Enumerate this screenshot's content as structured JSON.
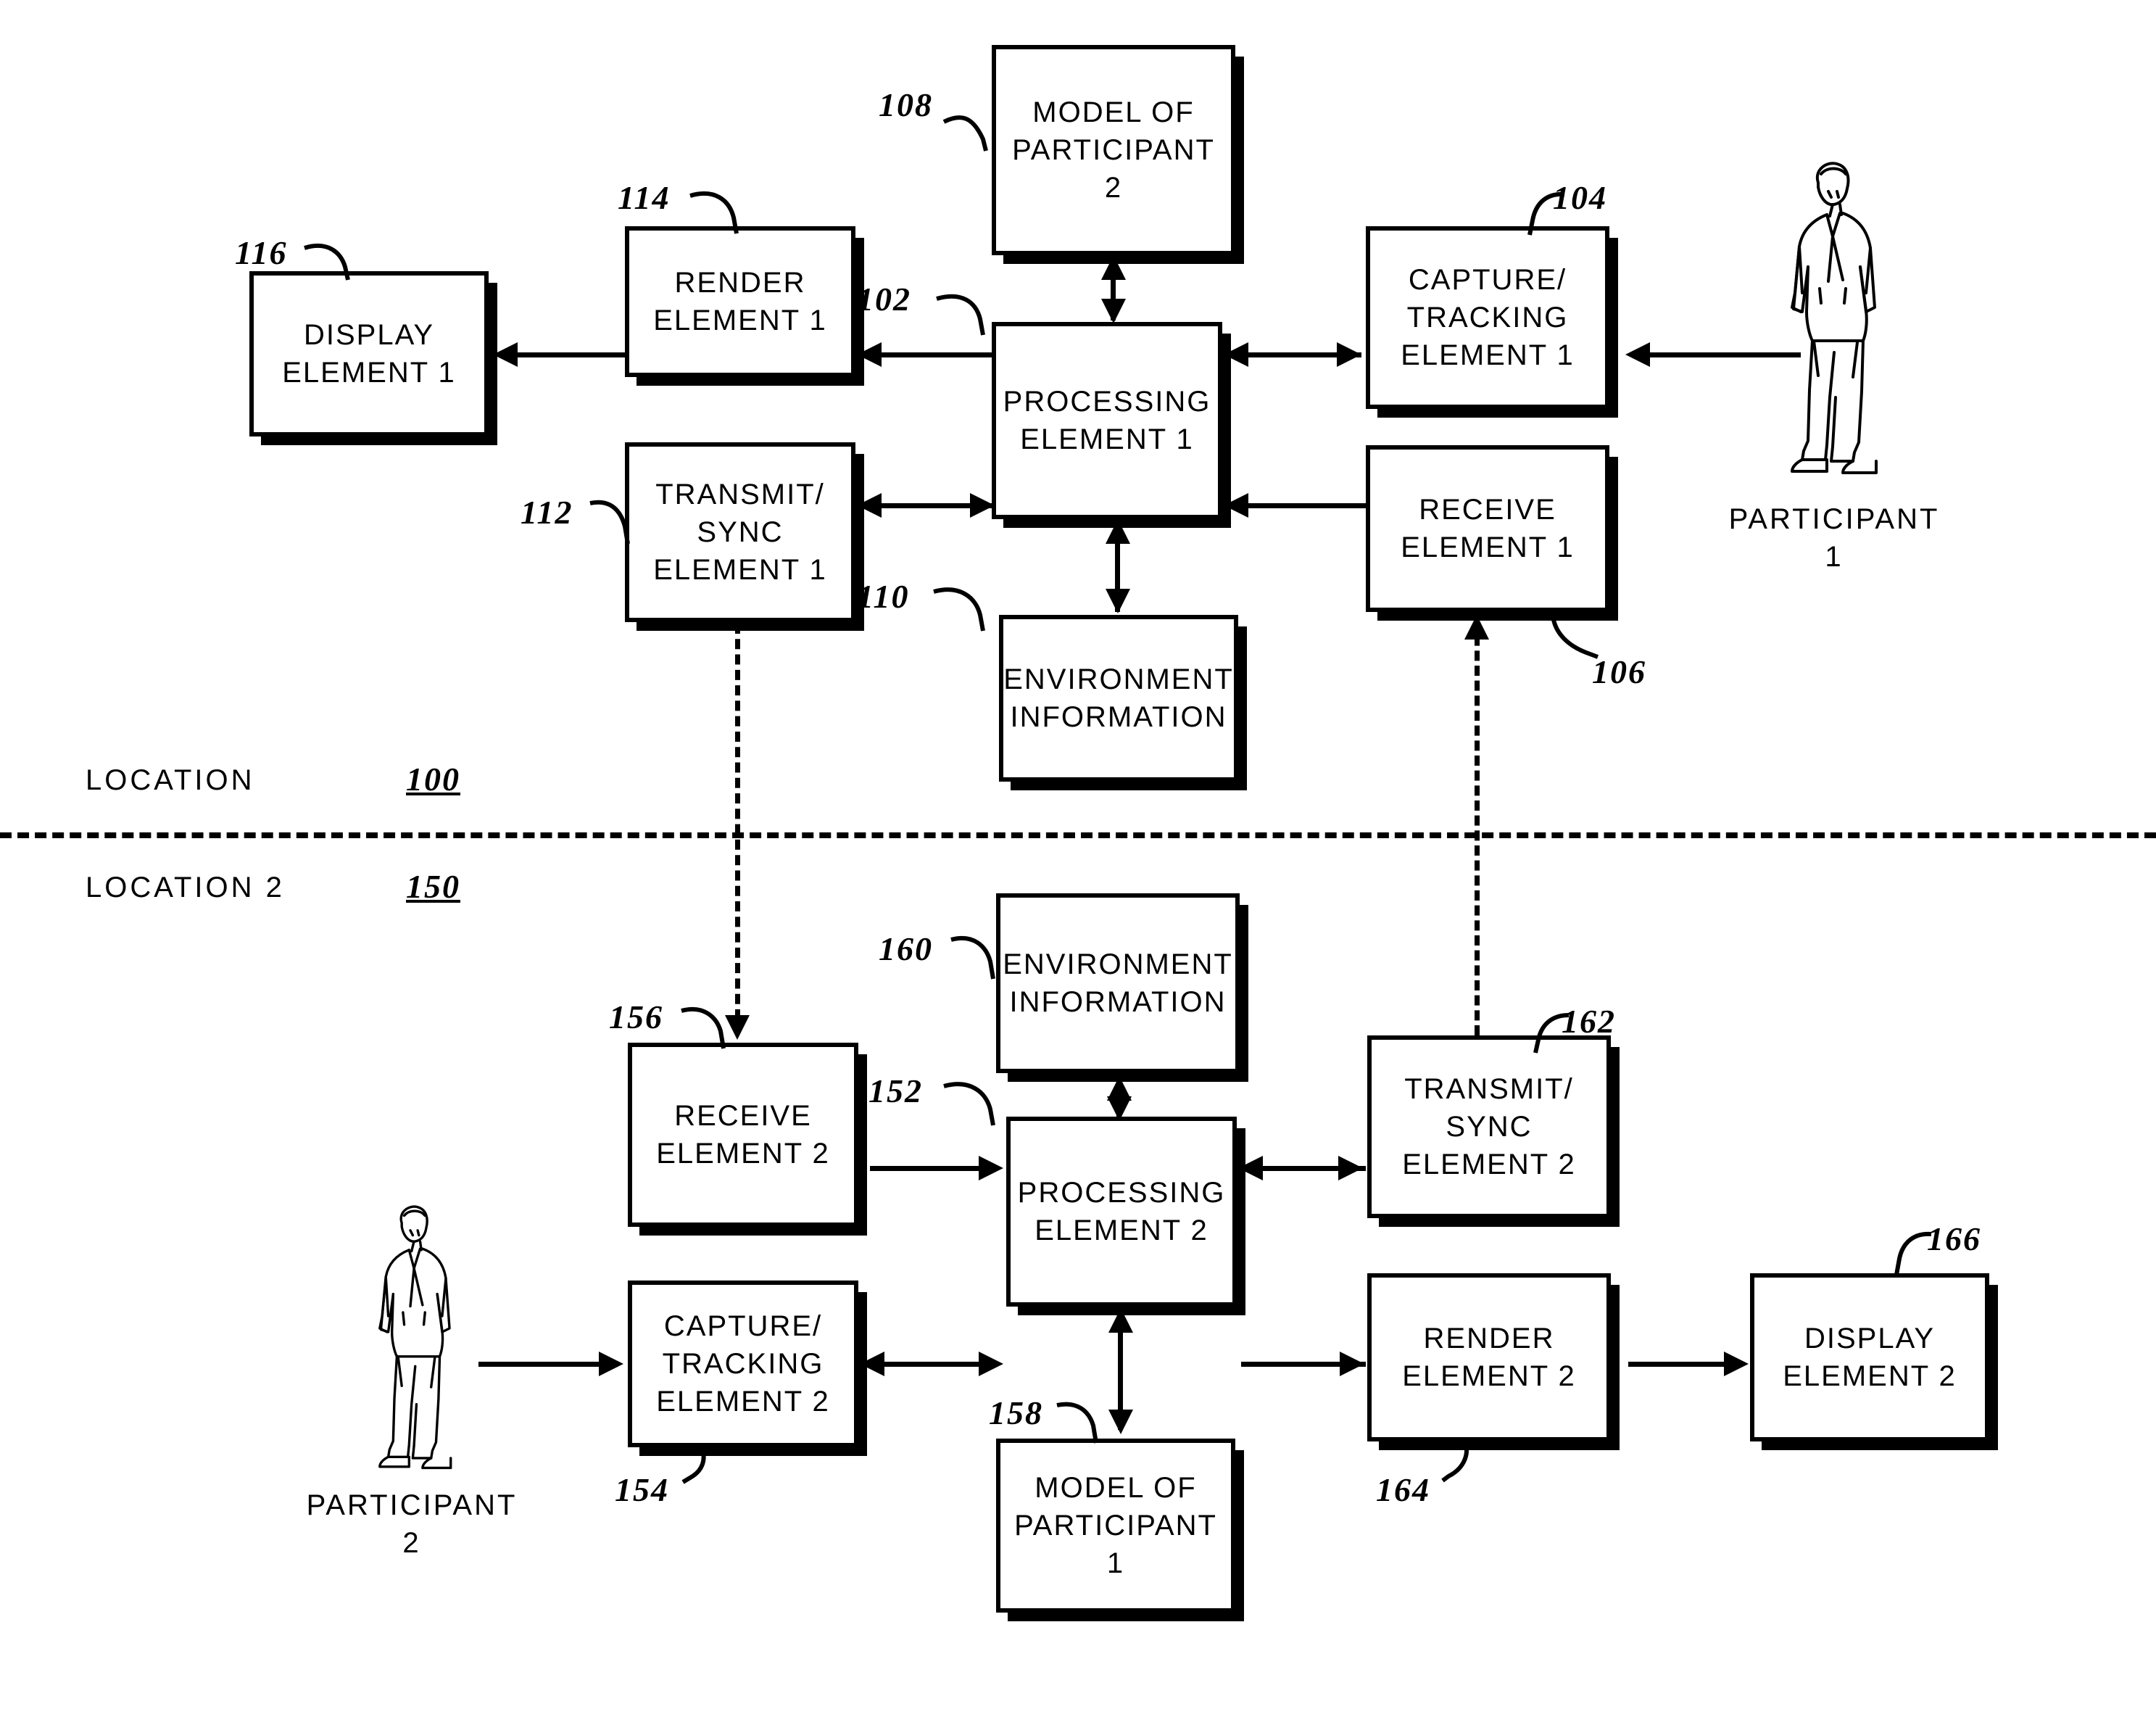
{
  "figure_title": "",
  "locations": {
    "top": {
      "label": "LOCATION",
      "numeral": "100"
    },
    "bottom": {
      "label": "LOCATION 2",
      "numeral": "150"
    }
  },
  "participants": [
    {
      "id": "participant-1",
      "label": "PARTICIPANT\n1",
      "icon": "standing-person-icon"
    },
    {
      "id": "participant-2",
      "label": "PARTICIPANT\n2",
      "icon": "standing-person-icon"
    }
  ],
  "boxes": [
    {
      "id": "display-element-1",
      "text": "DISPLAY\nELEMENT 1",
      "numeral": "116"
    },
    {
      "id": "render-element-1",
      "text": "RENDER\nELEMENT 1",
      "numeral": "114"
    },
    {
      "id": "transmit-sync-element-1",
      "text": "TRANSMIT/\nSYNC\nELEMENT 1",
      "numeral": "112"
    },
    {
      "id": "processing-element-1",
      "text": "PROCESSING\nELEMENT 1",
      "numeral": "102"
    },
    {
      "id": "model-of-participant-2",
      "text": "MODEL OF\nPARTICIPANT\n2",
      "numeral": "108"
    },
    {
      "id": "environment-information-1",
      "text": "ENVIRONMENT\nINFORMATION",
      "numeral": "110"
    },
    {
      "id": "capture-tracking-element-1",
      "text": "CAPTURE/\nTRACKING\nELEMENT 1",
      "numeral": "104"
    },
    {
      "id": "receive-element-1",
      "text": "RECEIVE\nELEMENT 1",
      "numeral": "106"
    },
    {
      "id": "receive-element-2",
      "text": "RECEIVE\nELEMENT 2",
      "numeral": "156"
    },
    {
      "id": "environment-information-2",
      "text": "ENVIRONMENT\nINFORMATION",
      "numeral": "160"
    },
    {
      "id": "processing-element-2",
      "text": "PROCESSING\nELEMENT 2",
      "numeral": "152"
    },
    {
      "id": "transmit-sync-element-2",
      "text": "TRANSMIT/\nSYNC\nELEMENT 2",
      "numeral": "162"
    },
    {
      "id": "capture-tracking-element-2",
      "text": "CAPTURE/\nTRACKING\nELEMENT 2",
      "numeral": "154"
    },
    {
      "id": "model-of-participant-1",
      "text": "MODEL OF\nPARTICIPANT\n1",
      "numeral": "158"
    },
    {
      "id": "render-element-2",
      "text": "RENDER\nELEMENT 2",
      "numeral": "164"
    },
    {
      "id": "display-element-2",
      "text": "DISPLAY\nELEMENT 2",
      "numeral": "166"
    }
  ],
  "colors": {
    "ink": "#000000",
    "paper": "#ffffff"
  }
}
